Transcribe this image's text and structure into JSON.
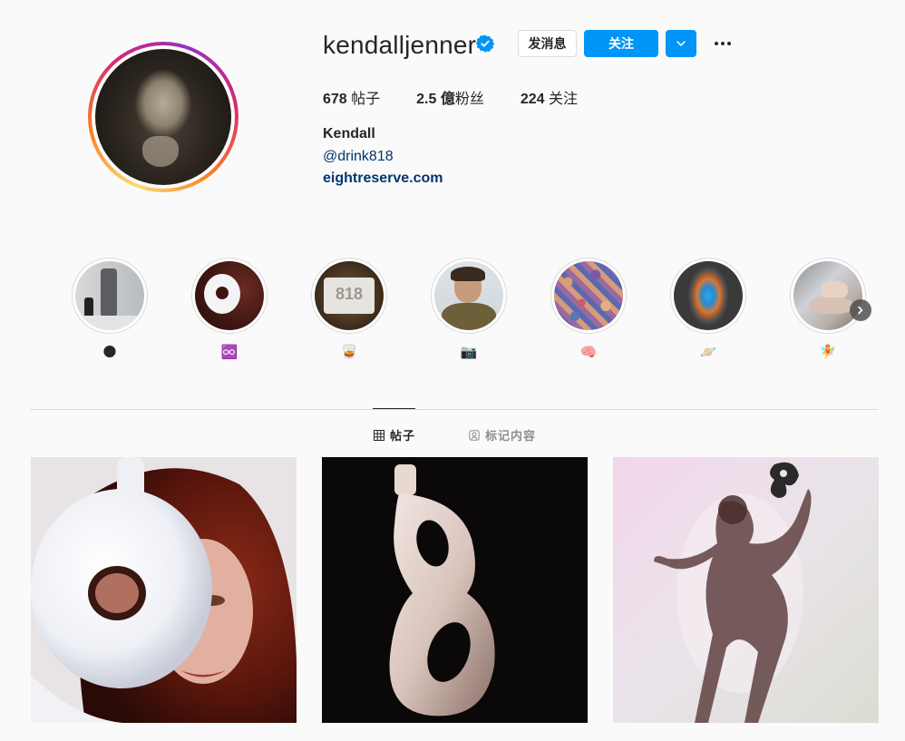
{
  "profile": {
    "username": "kendalljenner",
    "verified": true,
    "message_label": "发消息",
    "follow_label": "关注",
    "posts_count": "678",
    "posts_label": " 帖子",
    "followers_count": "2.5 億",
    "followers_label": "粉丝",
    "following_count": "224",
    "following_label": " 关注",
    "full_name": "Kendall",
    "bio_handle": "@drink818",
    "website": "eightreserve.com"
  },
  "highlights": [
    {
      "label": "🌑",
      "icon": "moon-emoji"
    },
    {
      "label": "♾️",
      "icon": "infinity-emoji"
    },
    {
      "label": "🥃",
      "icon": "tumbler-glass-emoji"
    },
    {
      "label": "📷",
      "icon": "camera-emoji"
    },
    {
      "label": "🧠",
      "icon": "brain-emoji"
    },
    {
      "label": "🪐",
      "icon": "planet-emoji"
    },
    {
      "label": "🧚",
      "icon": "fairy-emoji"
    }
  ],
  "tabs": [
    {
      "label": "帖子",
      "icon": "grid-icon",
      "active": true
    },
    {
      "label": "标记内容",
      "icon": "tagged-icon",
      "active": false
    }
  ],
  "colors": {
    "accent": "#0095f6",
    "link": "#00376b",
    "text": "#262626",
    "muted": "#8e8e8e",
    "border": "#dbdbdb",
    "background": "#fafafa"
  }
}
